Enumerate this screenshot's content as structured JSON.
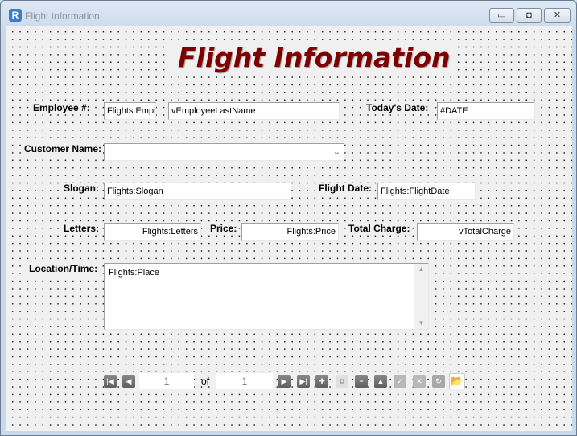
{
  "window": {
    "title": "Flight Information",
    "minimize": "▭",
    "maximize": "◘",
    "close": "✕"
  },
  "form": {
    "heading": "Flight Information",
    "employee_label": "Employee  #:",
    "employee_value": "Flights:Emplo",
    "employee_last_name": "vEmployeeLastName",
    "todays_date_label": "Today's Date:",
    "todays_date_value": "#DATE",
    "customer_label": "Customer Name:",
    "customer_value": "",
    "slogan_label": "Slogan:",
    "slogan_value": "Flights:Slogan",
    "flight_date_label": "Flight Date:",
    "flight_date_value": "Flights:FlightDate",
    "letters_label": "Letters:",
    "letters_value": "Flights:Letters",
    "price_label": "Price:",
    "price_value": "Flights:Price",
    "total_label": "Total Charge:",
    "total_value": "vTotalCharge",
    "location_label": "Location/Time:",
    "location_value": "Flights:Place"
  },
  "navigator": {
    "current": "1",
    "of_label": "of",
    "total": "1",
    "buttons": [
      "first",
      "previous",
      "next",
      "last",
      "add",
      "copy",
      "delete",
      "up",
      "save",
      "cancel",
      "refresh",
      "open"
    ]
  }
}
